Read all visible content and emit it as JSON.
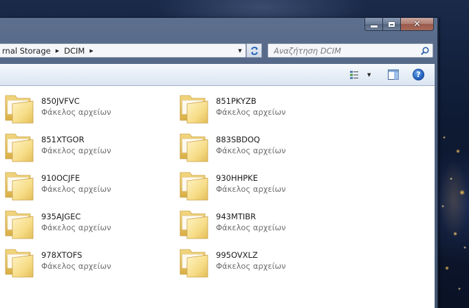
{
  "window": {
    "controls": {
      "minimize": "minimize",
      "maximize": "maximize",
      "close": "✕"
    }
  },
  "address_bar": {
    "crumbs": [
      "rnal Storage",
      "DCIM"
    ],
    "separator": "▶",
    "dropdown": "▼"
  },
  "search": {
    "placeholder": "Αναζήτηση DCIM"
  },
  "toolbar": {
    "view_dropdown": "▼",
    "help": "?"
  },
  "items": [
    {
      "name": "850JVFVC",
      "type": "Φάκελος αρχείων"
    },
    {
      "name": "851PKYZB",
      "type": "Φάκελος αρχείων"
    },
    {
      "name": "851XTGOR",
      "type": "Φάκελος αρχείων"
    },
    {
      "name": "883SBDOQ",
      "type": "Φάκελος αρχείων"
    },
    {
      "name": "910OCJFE",
      "type": "Φάκελος αρχείων"
    },
    {
      "name": "930HHPKE",
      "type": "Φάκελος αρχείων"
    },
    {
      "name": "935AJGEC",
      "type": "Φάκελος αρχείων"
    },
    {
      "name": "943MTIBR",
      "type": "Φάκελος αρχείων"
    },
    {
      "name": "978XTOFS",
      "type": "Φάκελος αρχείων"
    },
    {
      "name": "995OVXLZ",
      "type": "Φάκελος αρχείων"
    }
  ],
  "colors": {
    "folder_light": "#fbe9a6",
    "folder_dark": "#e8c25a",
    "accent_blue": "#1d5bb8"
  }
}
